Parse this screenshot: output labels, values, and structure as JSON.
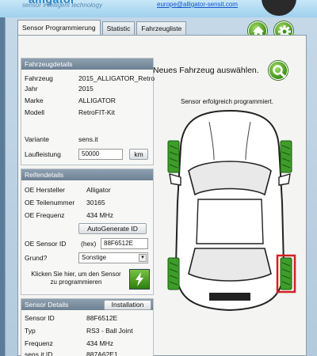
{
  "banner": {
    "logo_tagline": "sensor intelligent technology",
    "email": "europe@alligator-sensit.com"
  },
  "tabs": [
    {
      "label": "Sensor Programmierung",
      "active": true
    },
    {
      "label": "Statistic",
      "active": false
    },
    {
      "label": "Fahrzeugliste",
      "active": false
    }
  ],
  "header_icons": [
    "home-icon",
    "gear-icon"
  ],
  "fahrzeug": {
    "title": "Fahrzeugdetails",
    "rows": [
      {
        "label": "Fahrzeug",
        "value": "2015_ALLIGATOR_Retro"
      },
      {
        "label": "Jahr",
        "value": "2015"
      },
      {
        "label": "Marke",
        "value": "ALLIGATOR"
      },
      {
        "label": "Modell",
        "value": "RetroFIT-Kit"
      }
    ],
    "variante_label": "Variante",
    "variante_value": "sens.it",
    "laufleistung_label": "Laufleistung",
    "laufleistung_value": "50000",
    "unit_button": "km"
  },
  "reifen": {
    "title": "Reifendetails",
    "rows": [
      {
        "label": "OE Hersteller",
        "value": "Alligator"
      },
      {
        "label": "OE Teilenummer",
        "value": "30165"
      },
      {
        "label": "OE Frequenz",
        "value": "434 MHz"
      }
    ],
    "autogen_button": "AutoGenerate ID",
    "sensor_id_label": "OE Sensor ID",
    "hex_label": "(hex)",
    "sensor_id_value": "88F6512E",
    "grund_label": "Grund?",
    "grund_value": "Sonstige",
    "program_hint_line1": "Klicken Sie hier, um den Sensor",
    "program_hint_line2": "zu programmieren"
  },
  "sensor_details": {
    "title": "Sensor Details",
    "installation_button": "Installation",
    "rows": [
      {
        "label": "Sensor ID",
        "value": "88F6512E"
      },
      {
        "label": "Typ",
        "value": "RS3 - Ball Joint"
      },
      {
        "label": "Frequenz",
        "value": "434 MHz"
      },
      {
        "label": "sens.it ID",
        "value": "887A62E1"
      }
    ]
  },
  "right": {
    "select_vehicle": "Neues Fahrzeug auswählen.",
    "status": "Sensor erfolgreich programmiert."
  },
  "colors": {
    "tire_green": "#3e9d2a",
    "tire_highlight": "#d42020",
    "panel_header": "#6d8193"
  },
  "car": {
    "tires": [
      {
        "position": "front-left",
        "state": "ok"
      },
      {
        "position": "front-right",
        "state": "ok"
      },
      {
        "position": "rear-left",
        "state": "ok"
      },
      {
        "position": "rear-right",
        "state": "selected"
      }
    ]
  }
}
